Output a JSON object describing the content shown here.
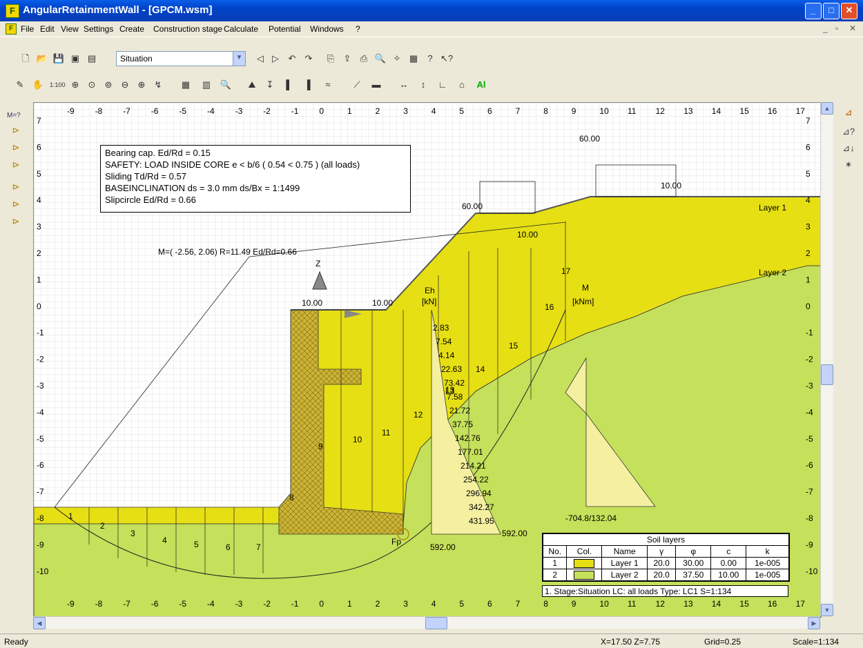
{
  "window": {
    "title": "AngularRetainmentWall - [GPCM.wsm]",
    "app_icon_letter": "F"
  },
  "menu": {
    "items": [
      "File",
      "Edit",
      "View",
      "Settings",
      "Create",
      "Construction stage",
      "Calculate",
      "Potential",
      "Windows",
      "?"
    ]
  },
  "toolbar": {
    "view_select": "Situation"
  },
  "left_tools": [
    "M=?"
  ],
  "right_tools": [],
  "info": {
    "lines": [
      "Bearing cap. Ed/Rd = 0.15",
      "SAFETY: LOAD INSIDE CORE e < b/6  (  0.54 < 0.75  )  (all loads)",
      "Sliding Td/Rd = 0.57",
      "BASEINCLINATION  ds =   3.0 mm   ds/Bx = 1:1499",
      "Slipcircle Ed/Rd = 0.66"
    ]
  },
  "drawing": {
    "x_ticks": [
      "-9",
      "-8",
      "-7",
      "-6",
      "-5",
      "-4",
      "-3",
      "-2",
      "-1",
      "0",
      "1",
      "2",
      "3",
      "4",
      "5",
      "6",
      "7",
      "8",
      "9",
      "10",
      "11",
      "12",
      "13",
      "14",
      "15",
      "16",
      "17"
    ],
    "y_ticks": [
      "7",
      "6",
      "5",
      "4",
      "3",
      "2",
      "1",
      "0",
      "-1",
      "-2",
      "-3",
      "-4",
      "-5",
      "-6",
      "-7",
      "-8",
      "-9",
      "-10"
    ],
    "circle_label": "M=( -2.56,  2.06) R=11.49  Ed/Rd=0.66",
    "load_60_right": "60.00",
    "load_10_right": "10.00",
    "load_60_mid": "60.00",
    "load_10_mid": "10.00",
    "load_10_left": "10.00",
    "load_10_left2": "10.00",
    "z_label": "Z",
    "eh_label": "Eh",
    "eh_unit": "[kN]",
    "m_label": "M",
    "m_unit": "[kNm]",
    "eh_values": [
      "2.83",
      "7.54",
      "4.14",
      "22.63",
      "73.42",
      "7.58",
      "21.72",
      "37.75",
      "142.76",
      "177.01",
      "214.21",
      "254.22",
      "296.94",
      "342.27",
      "431.95"
    ],
    "eh_max": "592.00",
    "eh_bottom": "592.00",
    "m_value": "-704.8/132.04",
    "layer1_label": "Layer 1",
    "layer2_label": "Layer 2",
    "l3_label": "L3",
    "fp_label": "Fp",
    "slice_numbers": [
      "1",
      "2",
      "3",
      "4",
      "5",
      "6",
      "7",
      "8",
      "9",
      "10",
      "11",
      "12",
      "13",
      "14",
      "15",
      "16",
      "17"
    ]
  },
  "soil_table": {
    "title": "Soil layers",
    "headers": [
      "No.",
      "Col.",
      "Name",
      "γ",
      "φ",
      "c",
      "k"
    ],
    "rows": [
      {
        "no": "1",
        "color": "#e6df14",
        "name": "Layer 1",
        "gamma": "20.0",
        "phi": "30.00",
        "c": "0.00",
        "k": "1e-005"
      },
      {
        "no": "2",
        "color": "#c5e05a",
        "name": "Layer 2",
        "gamma": "20.0",
        "phi": "37.50",
        "c": "10.00",
        "k": "1e-005"
      }
    ]
  },
  "stage_info": "1. Stage:Situation LC:   all loads  Type: LC1 S=1:134",
  "status": {
    "ready": "Ready",
    "coords": "X=17.50  Z=7.75",
    "grid": "Grid=0.25",
    "scale": "Scale=1:134"
  },
  "colors": {
    "layer1": "#e6df14",
    "layer2": "#c5e05a",
    "wall": "#cdb436",
    "titlebar": "#0a5ee8"
  }
}
